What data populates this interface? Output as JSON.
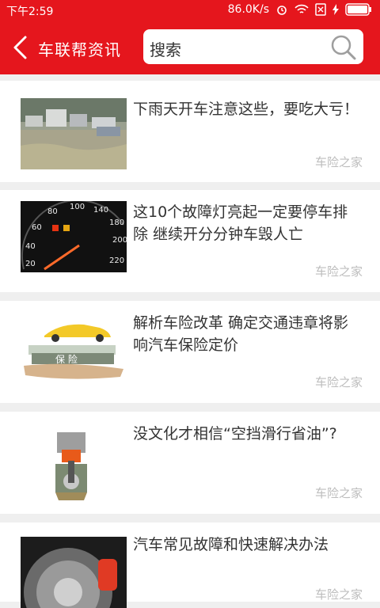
{
  "status": {
    "time": "下午2:59",
    "speed": "86.0K/s"
  },
  "header": {
    "title": "车联帮资讯",
    "search_placeholder": "搜索"
  },
  "articles": [
    {
      "title": "下雨天开车注意这些，要吃大亏！",
      "source": "车险之家",
      "thumb": "flooded-street-cars"
    },
    {
      "title": "这10个故障灯亮起一定要停车排除 继续开分分钟车毁人亡",
      "source": "车险之家",
      "thumb": "speedometer"
    },
    {
      "title": "解析车险改革 确定交通违章将影响汽车保险定价",
      "source": "车险之家",
      "thumb": "insurance-car"
    },
    {
      "title": "没文化才相信“空挡滑行省油”?",
      "source": "车险之家",
      "thumb": "engine-piston"
    },
    {
      "title": "汽车常见故障和快速解决办法",
      "source": "车险之家",
      "thumb": "brake-disc"
    }
  ]
}
